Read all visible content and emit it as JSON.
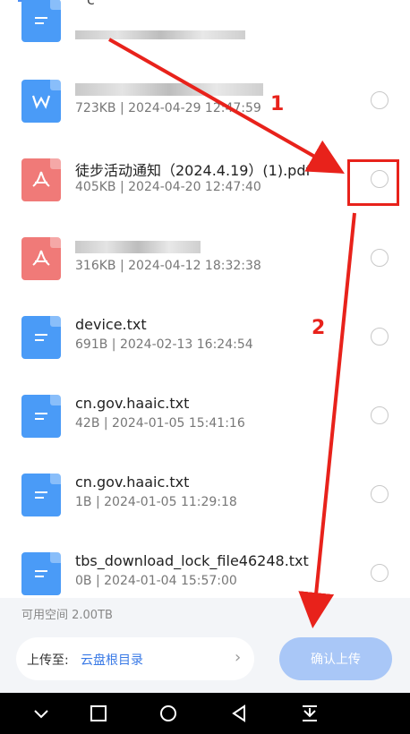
{
  "header": {
    "partial_char": "c"
  },
  "files": [
    {
      "type": "txt",
      "name": "",
      "meta": "",
      "blurred_name": true,
      "blurred_meta": true
    },
    {
      "type": "word",
      "name": "",
      "meta": "723KB | 2024-04-29 12:47:59",
      "blurred_name": true
    },
    {
      "type": "pdf",
      "name": "徒步活动通知（2024.4.19）(1).pdf",
      "meta": "405KB | 2024-04-20 12:47:40"
    },
    {
      "type": "pdf",
      "name": "",
      "meta": "316KB | 2024-04-12 18:32:38",
      "blurred_name": true
    },
    {
      "type": "txt",
      "name": "device.txt",
      "meta": "691B | 2024-02-13 16:24:54"
    },
    {
      "type": "txt",
      "name": "cn.gov.haaic.txt",
      "meta": "42B | 2024-01-05 15:41:16"
    },
    {
      "type": "txt",
      "name": "cn.gov.haaic.txt",
      "meta": "1B | 2024-01-05 11:29:18"
    },
    {
      "type": "txt",
      "name": "tbs_download_lock_file46248.txt",
      "meta": "0B | 2024-01-04 15:57:00"
    }
  ],
  "bottom": {
    "space_text": "可用空间 2.00TB",
    "dest_label": "上传至:",
    "dest_value": "云盘根目录",
    "confirm_label": "确认上传"
  },
  "annotations": {
    "step1": "1",
    "step2": "2",
    "color": "#e8221b"
  },
  "colors": {
    "word": "#4a9bf7",
    "pdf": "#f07a78",
    "txt": "#4a9bf7",
    "accent": "#3a7ae6"
  }
}
